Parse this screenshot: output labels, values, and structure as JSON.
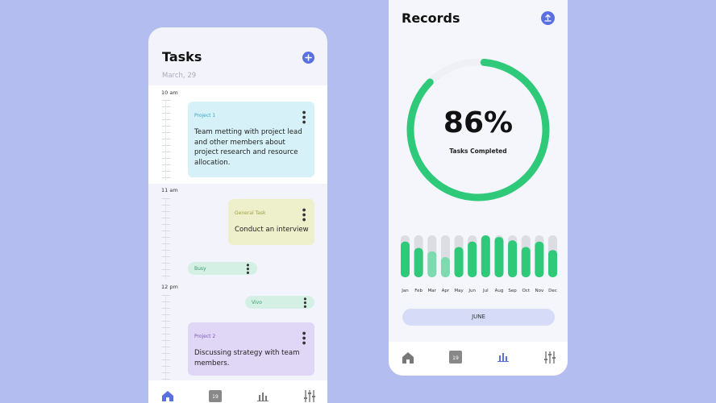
{
  "tasks": {
    "title": "Tasks",
    "add_icon": "plus-icon",
    "date": "March, 29",
    "time_labels": [
      "10 am",
      "11 am",
      "12 pm"
    ],
    "cards": {
      "project1": {
        "tag": "Project 1",
        "body": "Team metting with project lead and other members about project research and resource allocation."
      },
      "general": {
        "tag": "General Task",
        "body": "Conduct an interview"
      },
      "busy": {
        "tag": "Busy"
      },
      "vivo": {
        "tag": "Vivo"
      },
      "project2": {
        "tag": "Project 2",
        "body": "Discussing strategy with team members."
      }
    },
    "nav": [
      "home-icon",
      "calendar-icon",
      "chart-icon",
      "settings-sliders-icon"
    ],
    "calendar_day": "19"
  },
  "records": {
    "title": "Records",
    "upload_icon": "upload-icon",
    "percent": "86%",
    "percent_value": 0.86,
    "subtitle": "Tasks Completed",
    "selected_month": "JUNE",
    "calendar_day": "19",
    "nav": [
      "home-icon",
      "calendar-icon",
      "chart-icon",
      "settings-sliders-icon"
    ]
  },
  "colors": {
    "accent_blue": "#5a70e0",
    "green": "#2fc97a",
    "green_light": "#7edbb0",
    "track_gray": "#dcdde3",
    "background": "#b3bdf0"
  },
  "chart_data": {
    "type": "bar",
    "categories": [
      "Jan",
      "Feb",
      "Mar",
      "Apr",
      "May",
      "Jun",
      "Jul",
      "Aug",
      "Sep",
      "Oct",
      "Nov",
      "Dec"
    ],
    "values": [
      85,
      70,
      62,
      48,
      72,
      85,
      100,
      96,
      88,
      72,
      85,
      65
    ],
    "ylim": [
      0,
      100
    ]
  }
}
